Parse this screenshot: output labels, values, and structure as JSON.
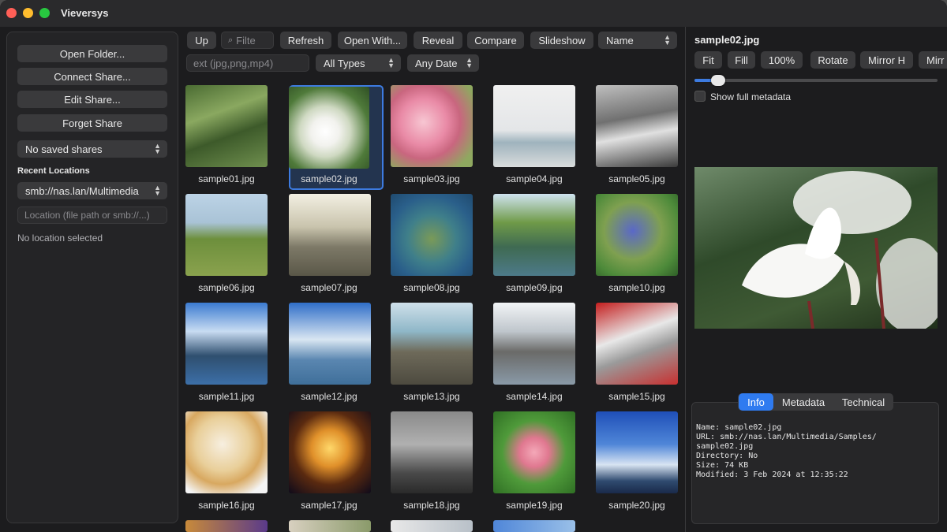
{
  "app": {
    "title": "Vieversys"
  },
  "sidebar": {
    "buttons": [
      "Open Folder...",
      "Connect Share...",
      "Edit Share...",
      "Forget Share"
    ],
    "saved_shares": "No saved shares",
    "recent_heading": "Recent Locations",
    "recent_selected": "smb://nas.lan/Multimedia",
    "location_placeholder": "Location (file path or smb://...)",
    "status": "No location selected"
  },
  "toolbar": {
    "up": "Up",
    "filter_placeholder": "Filte",
    "refresh": "Refresh",
    "open_with": "Open With...",
    "reveal": "Reveal",
    "compare": "Compare",
    "slideshow": "Slideshow",
    "sort": "Name",
    "ext_placeholder": "ext (jpg,png,mp4)",
    "type_filter": "All Types",
    "date_filter": "Any Date"
  },
  "grid": {
    "items": [
      "sample01.jpg",
      "sample02.jpg",
      "sample03.jpg",
      "sample04.jpg",
      "sample05.jpg",
      "sample06.jpg",
      "sample07.jpg",
      "sample08.jpg",
      "sample09.jpg",
      "sample10.jpg",
      "sample11.jpg",
      "sample12.jpg",
      "sample13.jpg",
      "sample14.jpg",
      "sample15.jpg",
      "sample16.jpg",
      "sample17.jpg",
      "sample18.jpg",
      "sample19.jpg",
      "sample20.jpg"
    ],
    "selected": "sample02.jpg"
  },
  "preview": {
    "title": "sample02.jpg",
    "controls": [
      "Fit",
      "Fill",
      "100%",
      "Rotate",
      "Mirror H",
      "Mirr"
    ],
    "zoom": 0.06,
    "show_metadata_label": "Show full metadata",
    "tabs": [
      "Info",
      "Metadata",
      "Technical"
    ],
    "active_tab": "Info",
    "info": {
      "name": "Name: sample02.jpg",
      "url1": "URL: smb://nas.lan/Multimedia/Samples/",
      "url2": "sample02.jpg",
      "directory": "Directory: No",
      "size": "Size: 74 KB",
      "modified": "Modified: 3 Feb 2024 at 12:35:22"
    }
  }
}
